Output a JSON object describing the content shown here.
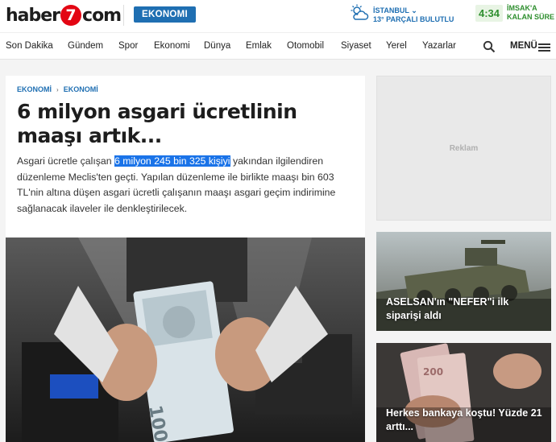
{
  "header": {
    "logo_left": "haber",
    "logo_seven": "7",
    "logo_right": "com",
    "section_badge": "EKONOMI",
    "weather": {
      "city": "İSTANBUL",
      "condition": "13° PARÇALI BULUTLU",
      "icon": "partly-cloudy-icon"
    },
    "prayer": {
      "time": "4:34",
      "label_line1": "İMSAK'A",
      "label_line2": "KALAN SÜRE"
    }
  },
  "nav": {
    "items": [
      "Son Dakika",
      "Gündem",
      "Spor",
      "Ekonomi",
      "Dünya",
      "Emlak",
      "Otomobil",
      "Siyaset",
      "Yerel",
      "Yazarlar"
    ],
    "menu_label": "MENÜ"
  },
  "article": {
    "breadcrumb": [
      "EKONOMİ",
      "EKONOMİ"
    ],
    "title": "6 milyon asgari ücretlinin maaşı artık...",
    "summary_before": "Asgari ücretle çalışan ",
    "summary_highlight": "6 milyon 245 bin 325 kişiyi",
    "summary_after": " yakından ilgilendiren düzenleme Meclis'ten geçti. Yapılan düzenleme ile birlikte maaşı bin 603 TL'nin altına düşen asgari ücretli çalışanın maaşı asgari geçim indirimine sağlanacak ilaveler ile denkleştirilecek."
  },
  "sidebar": {
    "ad_label": "Reklam",
    "cards": [
      {
        "caption": "ASELSAN'ın \"NEFER\"i ilk siparişi aldı"
      },
      {
        "caption": "Herkes bankaya koştu! Yüzde 21 arttı..."
      }
    ]
  },
  "colors": {
    "brand_red": "#e30613",
    "accent_blue": "#1f6fb2",
    "prayer_green": "#2f8f2f",
    "highlight": "#1a73e8"
  }
}
